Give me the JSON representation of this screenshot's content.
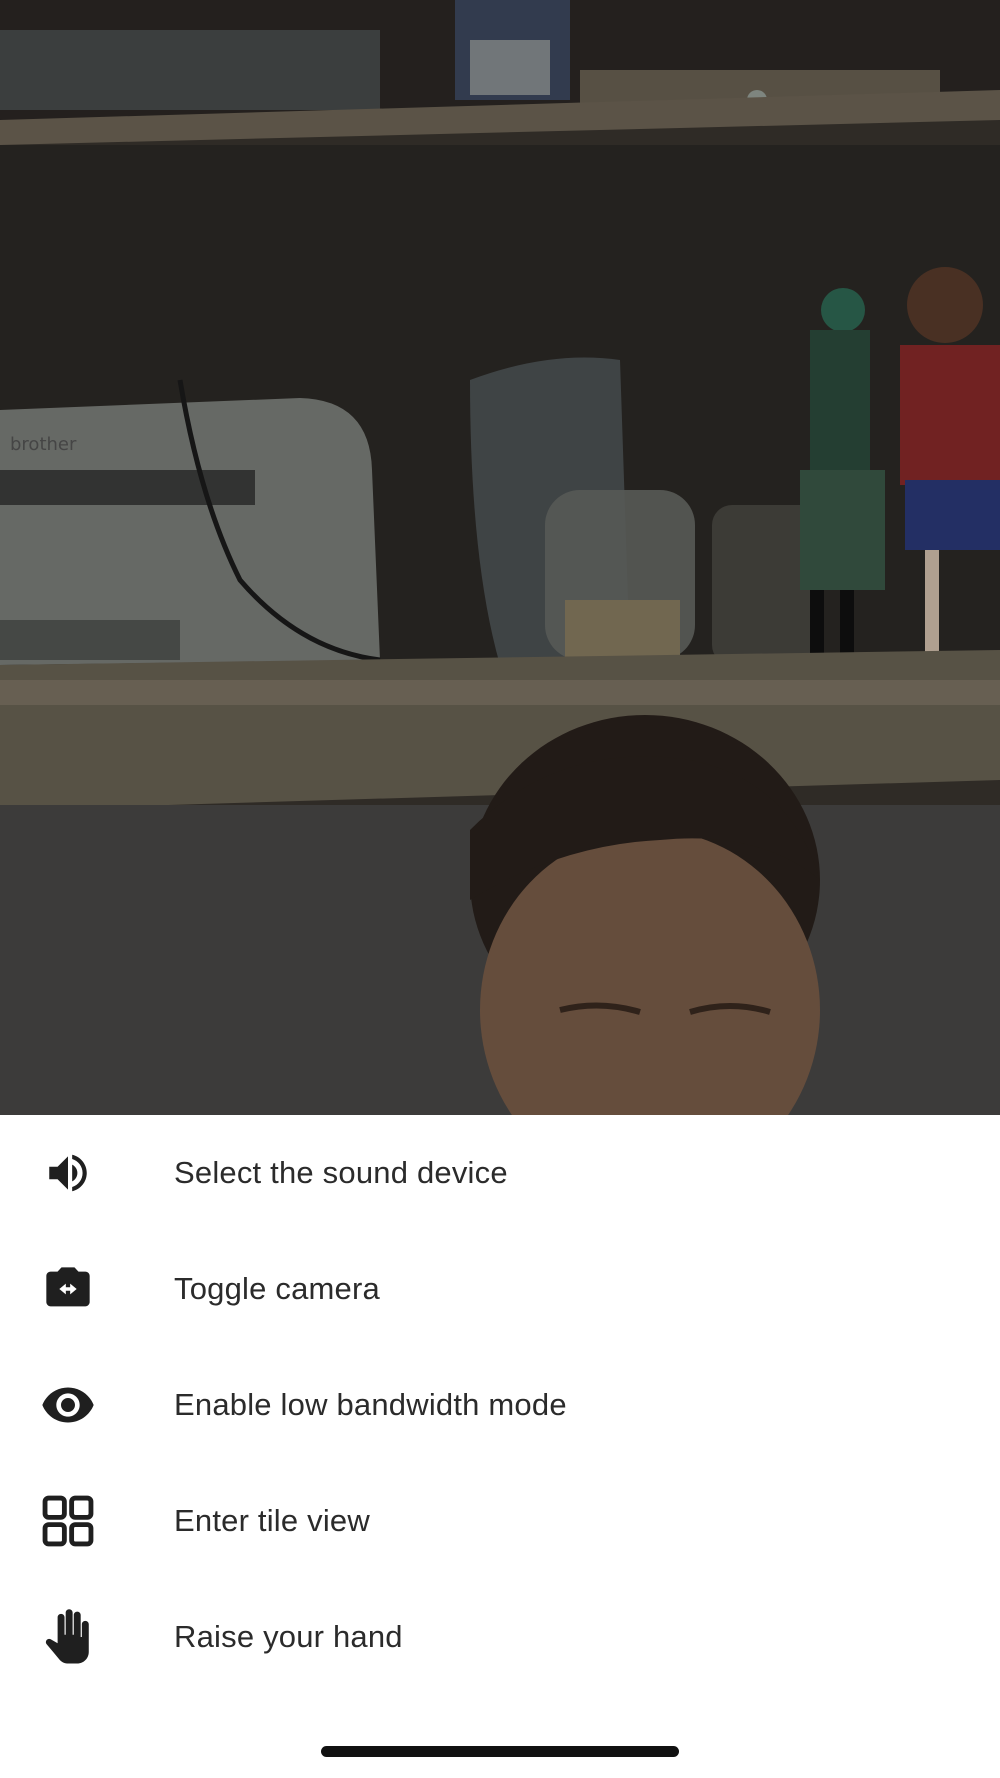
{
  "video": {
    "description_icon": "camera-feed"
  },
  "menu": {
    "items": [
      {
        "label": "Select the sound device",
        "icon": "speaker-icon"
      },
      {
        "label": "Toggle camera",
        "icon": "switch-camera-icon"
      },
      {
        "label": "Enable low bandwidth mode",
        "icon": "eye-icon"
      },
      {
        "label": "Enter tile view",
        "icon": "tile-grid-icon"
      },
      {
        "label": "Raise your hand",
        "icon": "hand-icon"
      }
    ]
  },
  "colors": {
    "sheet_bg": "#ffffff",
    "text": "#2b2b2b",
    "icon": "#1f1f1f"
  }
}
